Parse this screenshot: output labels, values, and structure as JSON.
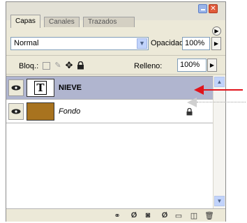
{
  "window": {
    "close_glyph": "✕"
  },
  "tabs": [
    {
      "label": "Capas",
      "active": true
    },
    {
      "label": "Canales",
      "active": false
    },
    {
      "label": "Trazados",
      "active": false
    }
  ],
  "blend": {
    "mode": "Normal",
    "opacity_label": "Opacidad:",
    "opacity_value": "100%"
  },
  "locks": {
    "label": "Bloq.:",
    "fill_label": "Relleno:",
    "fill_value": "100%"
  },
  "layers": [
    {
      "name": "NIEVE",
      "thumb_glyph": "T",
      "selected": true,
      "visible": true
    },
    {
      "name": "Fondo",
      "thumb_color": "#a8731f",
      "selected": false,
      "visible": true,
      "locked": true
    }
  ],
  "colors": {
    "selected_row": "#b0b5cf",
    "annotation": "#e0141c",
    "panel_bg": "#ece9d8"
  },
  "bottom_icons": [
    "link-icon",
    "layer-style-icon",
    "mask-icon",
    "adjustment-icon",
    "group-icon",
    "new-layer-icon",
    "trash-icon"
  ]
}
